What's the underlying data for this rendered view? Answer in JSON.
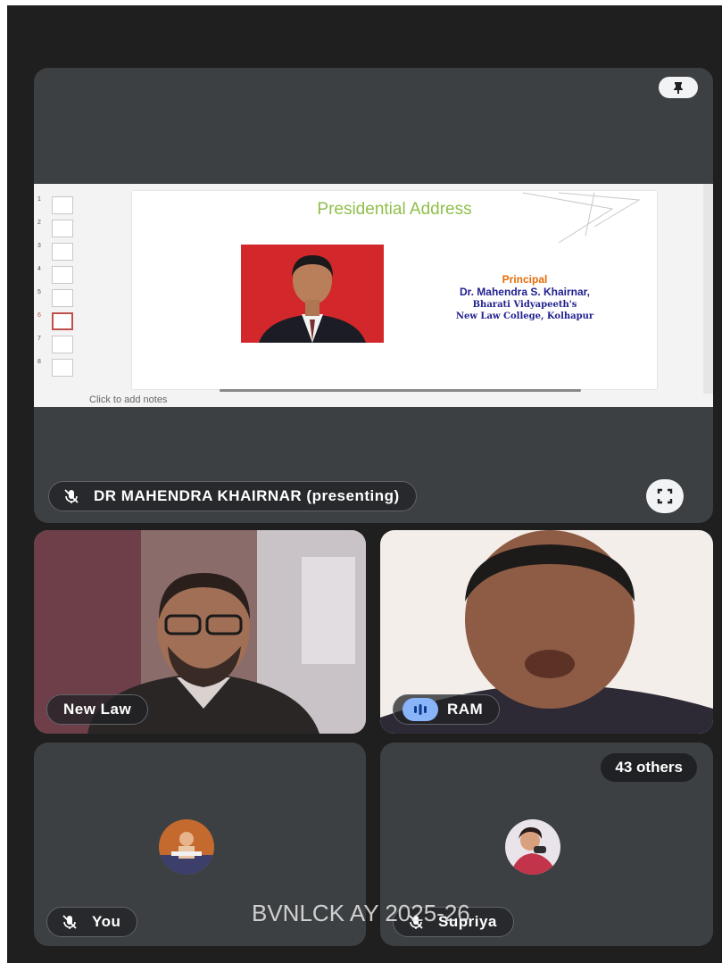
{
  "slide": {
    "title": "Presidential Address",
    "role": "Principal",
    "name": "Dr. Mahendra S. Khairnar,",
    "line1": "Bharati Vidyapeeth's",
    "line2": "New Law College, Kolhapur",
    "notes_placeholder": "Click to add notes",
    "thumbnails": [
      "1",
      "2",
      "3",
      "4",
      "5",
      "6",
      "7",
      "8"
    ]
  },
  "presenter_tile": {
    "label": "DR MAHENDRA KHAIRNAR (presenting)"
  },
  "participants": [
    {
      "label": "New Law"
    },
    {
      "label": "RAM"
    },
    {
      "label": "You"
    },
    {
      "label": "Supriya"
    }
  ],
  "others_badge": "43 others",
  "watermark": "BVNLCK AY 2025-26",
  "colors": {
    "tile_bg": "#3c4043",
    "screen_bg": "#1f1f1f",
    "speaking_indicator": "#8ab4f8",
    "slide_title": "#8fbf4a",
    "slide_role": "#e36c0a",
    "slide_name": "#1f1f8f"
  }
}
